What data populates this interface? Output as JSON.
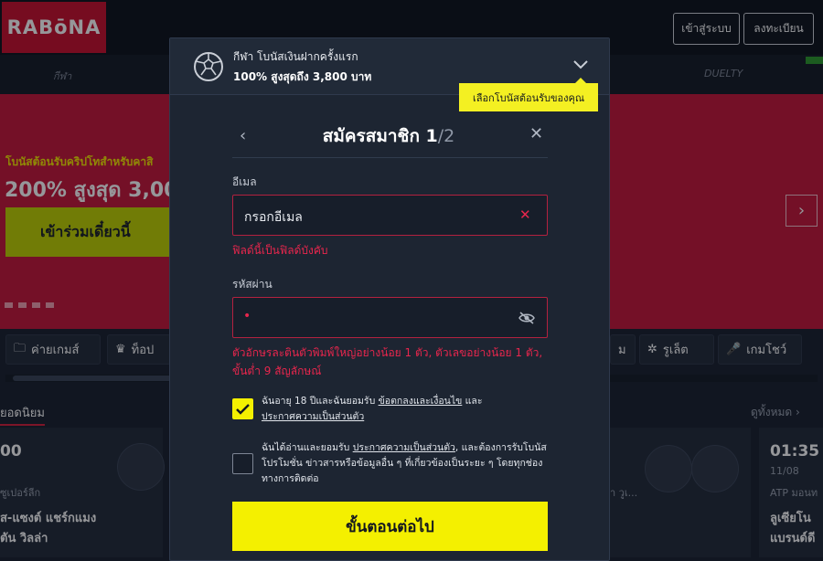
{
  "header": {
    "logo": "RABōNA",
    "login_label": "เข้าสู่ระบบ",
    "register_label": "ลงทะเบียน",
    "nav_sports": "กีฬา",
    "nav_duelty": "DUELTY"
  },
  "hero": {
    "subtitle": "โบนัสต้อนรับคริปโทสำหรับคาสิ",
    "title": "200% สูงสุด 3,000",
    "cta": "เข้าร่วมเดี๋ยวนี้"
  },
  "categories": [
    "ค่ายเกมส์",
    "ท็อป",
    "ม",
    "รูเล็ต",
    "เกมโชว์"
  ],
  "popular": {
    "title": "ยอดนิยม",
    "see_all": "ดูทั้งหมด"
  },
  "cards": {
    "left_time": "00",
    "left_league": "ซูเปอร์ลีก",
    "left_team1": "ส-แซงต์ แชร์กแมง",
    "left_team2": "ตัน วิลล่า",
    "right_time": "01:35",
    "right_date": "11/08",
    "right_league": "ATP มอนท",
    "right_player1": "ลูเซียโน",
    "right_player2": "แบรนด์ดี",
    "mid_text": "า วูเ..."
  },
  "bonus": {
    "title": "กีฬา โบนัสเงินฝากครั้งแรก",
    "amount": "100% สูงสุดถึง 3,800 บาท",
    "tooltip": "เลือกโบนัสต้อนรับของคุณ"
  },
  "signup": {
    "title": "สมัครสมาชิก 1",
    "step": "/2",
    "email_label": "อีเมล",
    "email_placeholder": "กรอกอีเมล",
    "email_error": "ฟิลด์นี้เป็นฟิลด์บังคับ",
    "password_label": "รหัสผ่าน",
    "password_value": "•",
    "password_error": "ตัวอักษรละตินตัวพิมพ์ใหญ่อย่างน้อย 1 ตัว, ตัวเลขอย่างน้อย 1 ตัว, ขั้นต่ำ 9 สัญลักษณ์",
    "terms_pre": "ฉันอายุ 18 ปีและฉันยอมรับ ",
    "terms_link": "ข้อตกลงและเงื่อนไข",
    "terms_mid": " และ",
    "privacy_link": "ประกาศความเป็นส่วนตัว",
    "terms_checked": true,
    "marketing_pre": "ฉันได้อ่านและยอมรับ ",
    "marketing_link": "ประกาศความเป็นส่วนตัว",
    "marketing_post": ", และต้องการรับโบนัส โปรโมชั่น ข่าวสารหรือข้อมูลอื่น ๆ ที่เกี่ยวข้องเป็นระยะ ๆ โดยทุกช่องทางการติดต่อ",
    "marketing_checked": false,
    "submit": "ขั้นตอนต่อไป"
  },
  "colors": {
    "accent": "#f4f000",
    "brand": "#c8102e",
    "error": "#e8264d"
  }
}
